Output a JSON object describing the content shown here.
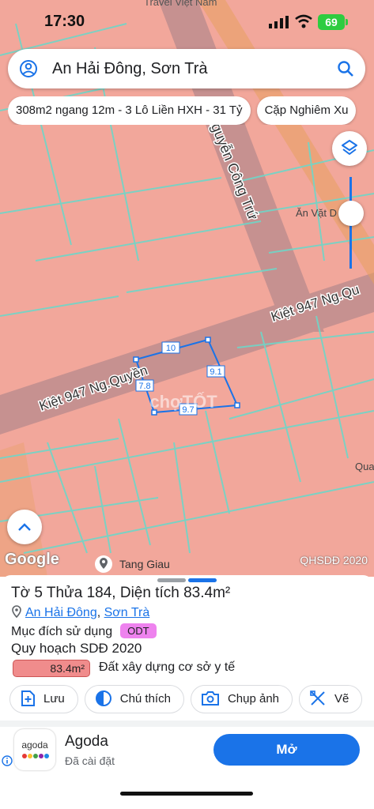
{
  "status_bar": {
    "time": "17:30",
    "battery": "69"
  },
  "map": {
    "top_label": "Travel Việt Nam",
    "street_nguyen_cong_tru": "Nguyễn Công Trứ",
    "street_kiet_right": "Kiệt 947 Ng.Qu",
    "street_kiet_left": "Kiệt 947 Ng.Quyền",
    "poi_right": "Ăn Vặt D",
    "poi_qua": "Qua",
    "dim_top": "10",
    "dim_right": "9.1",
    "dim_left": "7.8",
    "dim_bottom": "9.7",
    "watermark": "chợTỐT",
    "google": "Google",
    "layer_source": "QHSDĐ 2020",
    "poi_bottom": "Tang Giau"
  },
  "search": {
    "query": "An Hải Đông, Sơn Trà"
  },
  "chips": [
    {
      "label": "308m2 ngang 12m - 3 Lô Liền HXH - 31 Tỷ"
    },
    {
      "label": "Cặp Nghiêm Xu"
    }
  ],
  "parcel": {
    "title": "Tờ 5 Thửa 184, Diện tích 83.4m²",
    "ward": "An Hải Đông",
    "separator": ",",
    "district": "Sơn Trà",
    "purpose_label": "Mục đích sử dụng",
    "purpose_code": "ODT",
    "plan_title": "Quy hoạch SDĐ 2020",
    "plan_area": "83.4m²",
    "plan_desc": "Đất xây dựng cơ sở y tế"
  },
  "actions": [
    {
      "label": "Lưu",
      "icon": "save-plus-icon"
    },
    {
      "label": "Chú thích",
      "icon": "legend-icon"
    },
    {
      "label": "Chụp ảnh",
      "icon": "camera-icon"
    },
    {
      "label": "Vẽ",
      "icon": "ruler-icon"
    }
  ],
  "ad": {
    "logo_text": "agoda",
    "name": "Agoda",
    "subtitle": "Đã cài đặt",
    "cta": "Mở"
  },
  "colors": {
    "land": "#f2a79b",
    "road": "#c69190",
    "boundary": "#6fd6c8",
    "accent": "#1a73e8",
    "badge": "#ee82ee"
  }
}
